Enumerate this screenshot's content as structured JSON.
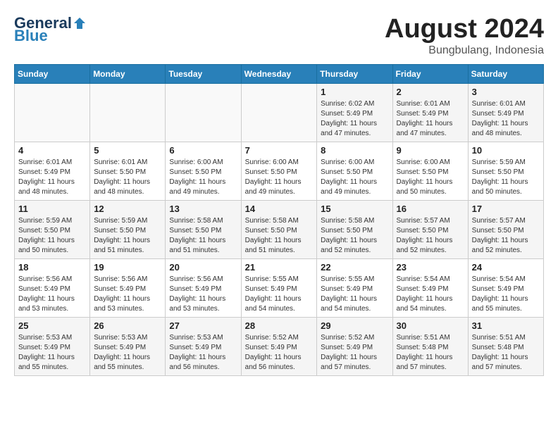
{
  "header": {
    "logo_general": "General",
    "logo_blue": "Blue",
    "title": "August 2024",
    "location": "Bungbulang, Indonesia"
  },
  "weekdays": [
    "Sunday",
    "Monday",
    "Tuesday",
    "Wednesday",
    "Thursday",
    "Friday",
    "Saturday"
  ],
  "weeks": [
    [
      {
        "day": "",
        "info": ""
      },
      {
        "day": "",
        "info": ""
      },
      {
        "day": "",
        "info": ""
      },
      {
        "day": "",
        "info": ""
      },
      {
        "day": "1",
        "info": "Sunrise: 6:02 AM\nSunset: 5:49 PM\nDaylight: 11 hours\nand 47 minutes."
      },
      {
        "day": "2",
        "info": "Sunrise: 6:01 AM\nSunset: 5:49 PM\nDaylight: 11 hours\nand 47 minutes."
      },
      {
        "day": "3",
        "info": "Sunrise: 6:01 AM\nSunset: 5:49 PM\nDaylight: 11 hours\nand 48 minutes."
      }
    ],
    [
      {
        "day": "4",
        "info": "Sunrise: 6:01 AM\nSunset: 5:49 PM\nDaylight: 11 hours\nand 48 minutes."
      },
      {
        "day": "5",
        "info": "Sunrise: 6:01 AM\nSunset: 5:50 PM\nDaylight: 11 hours\nand 48 minutes."
      },
      {
        "day": "6",
        "info": "Sunrise: 6:00 AM\nSunset: 5:50 PM\nDaylight: 11 hours\nand 49 minutes."
      },
      {
        "day": "7",
        "info": "Sunrise: 6:00 AM\nSunset: 5:50 PM\nDaylight: 11 hours\nand 49 minutes."
      },
      {
        "day": "8",
        "info": "Sunrise: 6:00 AM\nSunset: 5:50 PM\nDaylight: 11 hours\nand 49 minutes."
      },
      {
        "day": "9",
        "info": "Sunrise: 6:00 AM\nSunset: 5:50 PM\nDaylight: 11 hours\nand 50 minutes."
      },
      {
        "day": "10",
        "info": "Sunrise: 5:59 AM\nSunset: 5:50 PM\nDaylight: 11 hours\nand 50 minutes."
      }
    ],
    [
      {
        "day": "11",
        "info": "Sunrise: 5:59 AM\nSunset: 5:50 PM\nDaylight: 11 hours\nand 50 minutes."
      },
      {
        "day": "12",
        "info": "Sunrise: 5:59 AM\nSunset: 5:50 PM\nDaylight: 11 hours\nand 51 minutes."
      },
      {
        "day": "13",
        "info": "Sunrise: 5:58 AM\nSunset: 5:50 PM\nDaylight: 11 hours\nand 51 minutes."
      },
      {
        "day": "14",
        "info": "Sunrise: 5:58 AM\nSunset: 5:50 PM\nDaylight: 11 hours\nand 51 minutes."
      },
      {
        "day": "15",
        "info": "Sunrise: 5:58 AM\nSunset: 5:50 PM\nDaylight: 11 hours\nand 52 minutes."
      },
      {
        "day": "16",
        "info": "Sunrise: 5:57 AM\nSunset: 5:50 PM\nDaylight: 11 hours\nand 52 minutes."
      },
      {
        "day": "17",
        "info": "Sunrise: 5:57 AM\nSunset: 5:50 PM\nDaylight: 11 hours\nand 52 minutes."
      }
    ],
    [
      {
        "day": "18",
        "info": "Sunrise: 5:56 AM\nSunset: 5:49 PM\nDaylight: 11 hours\nand 53 minutes."
      },
      {
        "day": "19",
        "info": "Sunrise: 5:56 AM\nSunset: 5:49 PM\nDaylight: 11 hours\nand 53 minutes."
      },
      {
        "day": "20",
        "info": "Sunrise: 5:56 AM\nSunset: 5:49 PM\nDaylight: 11 hours\nand 53 minutes."
      },
      {
        "day": "21",
        "info": "Sunrise: 5:55 AM\nSunset: 5:49 PM\nDaylight: 11 hours\nand 54 minutes."
      },
      {
        "day": "22",
        "info": "Sunrise: 5:55 AM\nSunset: 5:49 PM\nDaylight: 11 hours\nand 54 minutes."
      },
      {
        "day": "23",
        "info": "Sunrise: 5:54 AM\nSunset: 5:49 PM\nDaylight: 11 hours\nand 54 minutes."
      },
      {
        "day": "24",
        "info": "Sunrise: 5:54 AM\nSunset: 5:49 PM\nDaylight: 11 hours\nand 55 minutes."
      }
    ],
    [
      {
        "day": "25",
        "info": "Sunrise: 5:53 AM\nSunset: 5:49 PM\nDaylight: 11 hours\nand 55 minutes."
      },
      {
        "day": "26",
        "info": "Sunrise: 5:53 AM\nSunset: 5:49 PM\nDaylight: 11 hours\nand 55 minutes."
      },
      {
        "day": "27",
        "info": "Sunrise: 5:53 AM\nSunset: 5:49 PM\nDaylight: 11 hours\nand 56 minutes."
      },
      {
        "day": "28",
        "info": "Sunrise: 5:52 AM\nSunset: 5:49 PM\nDaylight: 11 hours\nand 56 minutes."
      },
      {
        "day": "29",
        "info": "Sunrise: 5:52 AM\nSunset: 5:49 PM\nDaylight: 11 hours\nand 57 minutes."
      },
      {
        "day": "30",
        "info": "Sunrise: 5:51 AM\nSunset: 5:48 PM\nDaylight: 11 hours\nand 57 minutes."
      },
      {
        "day": "31",
        "info": "Sunrise: 5:51 AM\nSunset: 5:48 PM\nDaylight: 11 hours\nand 57 minutes."
      }
    ]
  ]
}
